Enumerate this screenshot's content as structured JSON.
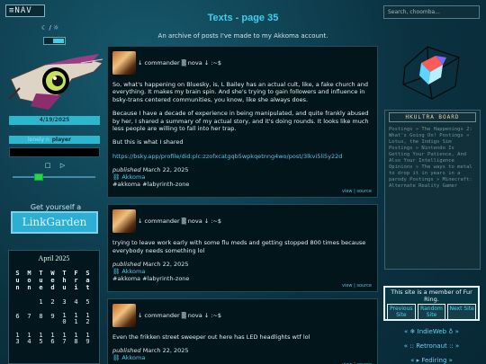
{
  "nav": {
    "label": "≡NAV"
  },
  "theme": {
    "icons": "☾ / ☼"
  },
  "sidebar": {
    "date": "4/19/2025",
    "player_song": "lonely n",
    "player_label": "player",
    "player_controls": "□ ▷",
    "linkgarden_title": "Get yourself a",
    "linkgarden_button": "LinkGarden"
  },
  "calendar": {
    "title": "April 2025",
    "headers": [
      "S\nu\nn",
      "M\no\nn",
      "T\nu\ne",
      "W\ne\nd",
      "T\nh\nu",
      "F\nr\ni",
      "S\na\nt"
    ],
    "weeks": [
      [
        "",
        "",
        "1",
        "2",
        "3",
        "4",
        "5"
      ],
      [
        "6",
        "7",
        "8",
        "9",
        "1\n0",
        "1\n1",
        "1\n2"
      ],
      [
        "1\n3",
        "1\n4",
        "1\n5",
        "1\n6",
        "1\n7",
        "1\n8",
        "1\n9"
      ]
    ]
  },
  "header": {
    "title": "Texts - page 35",
    "subtitle": "An archive of posts I've made to my Akkoma account.",
    "search_placeholder": "Search, choomba..."
  },
  "posts": [
    {
      "author": "↓ commander ▒ nova ↓ :~$",
      "paragraphs": [
        "So, what's happening on Bluesky, is, L Bailey has an actual cult, like, a fake church and everything. It makes my brain spin. And she's trying to gain followers and influence in bsky-trans centered communities, you know, like she always does.",
        "Because I have a decade of experience in being manipulated, and quite frankly abused by her, I shared a summary of my actual story, and it's doing rounds. It looks like much less people are willing to fall into her trap.",
        "But this is what I shared"
      ],
      "link": "https://bsky.app/profile/did:plc:zzofxcatgqb5wpkqetnng4wo/post/3lkvi5li5y22d",
      "published_label": "published",
      "date": "March 22, 2025",
      "network": "⛓ Akkoma",
      "tags": "#akkoma #labyrinth-zone",
      "view": "view",
      "source": "source"
    },
    {
      "author": "↓ commander ▒ nova ↓ :~$",
      "paragraphs": [
        "trying to leave work early with some flu meds and getting stopped 800 times because everybody needs something lol"
      ],
      "published_label": "published",
      "date": "March 22, 2025",
      "network": "⛓ Akkoma",
      "tags": "#akkoma #labyrinth-zone",
      "view": "view",
      "source": "source"
    },
    {
      "author": "↓ commander ▒ nova ↓ :~$",
      "paragraphs": [
        "Even the frikken street sweeper out here has LED headlights wtf lol"
      ],
      "published_label": "published",
      "date": "March 22, 2025",
      "network": "⛓ Akkoma",
      "tags": "",
      "view": "view",
      "source": "source"
    }
  ],
  "blogroll": {
    "title": "HKULTRA BOARD",
    "items": "Postings » The Happenings 2: What's Going On! Postings » Lotus, the Indigo Sim Postings » Nintendo Is Getting Your Patience, And Also Your Intelligence Opinions » The ways to metal to drop it in years in a parody Postings » Minecraft: Alternate Reality Gamer"
  },
  "webring": {
    "text": "This site is a member of Fur Ring.",
    "prev": "Previous Site",
    "random": "Random Site",
    "next": "Next Site"
  },
  "links": {
    "indieweb": "« ❄ IndieWeb ♁ »",
    "retronaut": "« :: Retronaut :: »",
    "fediring": "« ▸ Fediring »"
  },
  "colors": {
    "accent": "#3ccfed",
    "background": "#0e3a4a",
    "card": "#02151b"
  }
}
